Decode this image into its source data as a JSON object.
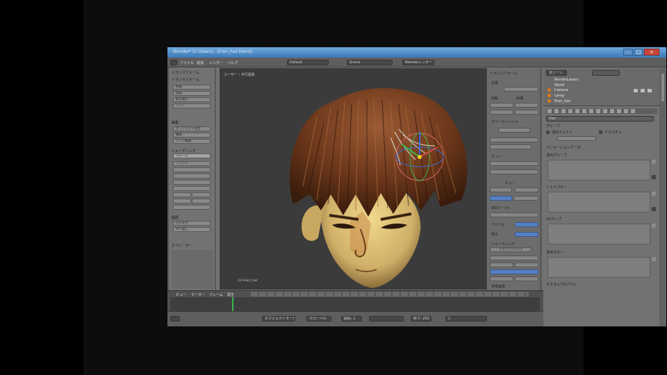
{
  "window": {
    "title": "Blender* [C:\\Users\\...\\Eren_hair.blend]"
  },
  "header": {
    "menus": [
      "ファイル",
      "追加",
      "レンダー",
      "ヘルプ"
    ],
    "layout": "Default",
    "scene": "Scene",
    "engine": "Blenderレンダー"
  },
  "toolshelf": {
    "title": "トランスフォーム",
    "sections": [
      {
        "title": "トランスフォーム",
        "items": [
          "移動",
          "回転",
          "拡大縮小",
          "ミラー"
        ]
      },
      {
        "title": "編集",
        "items": [
          "オブジェクト結合",
          "複製",
          "リンク複製"
        ]
      },
      {
        "title": "シェーディング",
        "items": [
          "スムーズ",
          "フラット"
        ]
      },
      {
        "title": "履歴",
        "items": [
          "元に戻す",
          "やり直し"
        ]
      }
    ],
    "footer": "オペレーター"
  },
  "viewport": {
    "label": "ユーザー・平行投影",
    "object_label": "(1) Eren_hair"
  },
  "props_panel": {
    "title": "トランスフォーム",
    "items": [
      "位置",
      "回転",
      "拡縮",
      "寸法",
      "グリースペンシル",
      "ビュー",
      "3Dカーソル",
      "アイテム",
      "表示",
      "シェーディング",
      "モーション",
      "背景画像"
    ],
    "view_label": "ビュー",
    "shading_value": "マルチテクスチャ"
  },
  "outliner": {
    "view": "全シーン",
    "items": [
      "RenderLayers",
      "World",
      "Camera",
      "Lamp",
      "Eren_hair"
    ]
  },
  "properties": {
    "tabs_count": 11,
    "object_name": "Hair",
    "sections": [
      "グループ",
      "アニメーションデータ",
      "頂点グループ",
      "シェイプキー",
      "UVマップ",
      "頂点カラー",
      "カスタムプロパティ"
    ],
    "buttons": [
      "頂点ウェイト",
      "テクスチャ"
    ]
  },
  "timeline": {
    "labels": [
      "ビュー",
      "マーカー",
      "フレーム",
      "再生"
    ],
    "start": "開始: 1",
    "end": "終了: 250",
    "current": "1"
  },
  "statusbar": {
    "mode": "オブジェクトモード",
    "pivot": "グローバル"
  },
  "colors": {
    "titlebar": "#4a8bcf",
    "ui_gray": "#727272",
    "viewport_bg": "#3b3b3b",
    "accent_blue": "#5680c2",
    "timeline_cursor": "#3bb84a",
    "hair": "#7a4422",
    "skin": "#d8bc72"
  }
}
